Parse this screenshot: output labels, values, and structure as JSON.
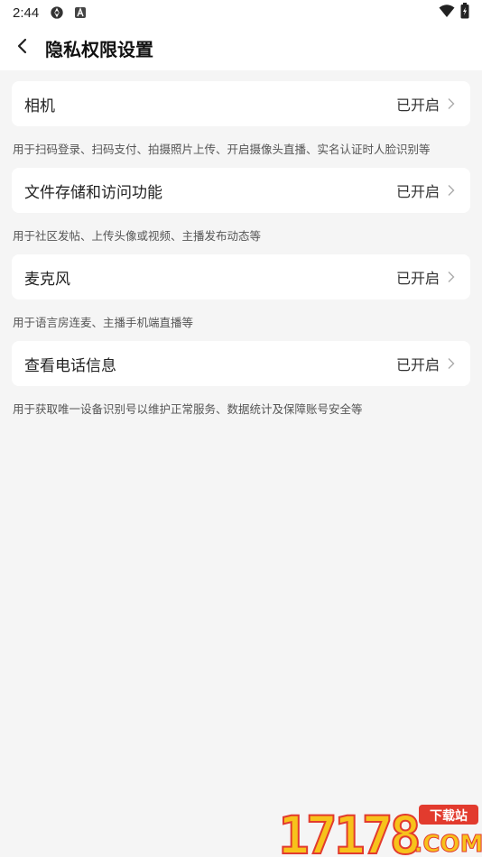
{
  "status_bar": {
    "time": "2:44",
    "icons": [
      "sync-icon",
      "a-app-icon",
      "wifi-icon",
      "battery-icon"
    ]
  },
  "header": {
    "back_icon": "chevron-left-icon",
    "title": "隐私权限设置"
  },
  "permissions": [
    {
      "name": "相机",
      "status": "已开启",
      "description": "用于扫码登录、扫码支付、拍摄照片上传、开启摄像头直播、实名认证时人脸识别等"
    },
    {
      "name": "文件存储和访问功能",
      "status": "已开启",
      "description": "用于社区发帖、上传头像或视频、主播发布动态等"
    },
    {
      "name": "麦克风",
      "status": "已开启",
      "description": "用于语言房连麦、主播手机端直播等"
    },
    {
      "name": "查看电话信息",
      "status": "已开启",
      "description": "用于获取唯一设备识别号以维护正常服务、数据统计及保障账号安全等"
    }
  ],
  "watermark": {
    "number": "17178",
    "tag": "下载站",
    "domain": ".COM"
  },
  "colors": {
    "background": "#f5f5f5",
    "card": "#ffffff",
    "watermark_yellow": "#f7c21b",
    "watermark_red": "#e23b2e"
  }
}
